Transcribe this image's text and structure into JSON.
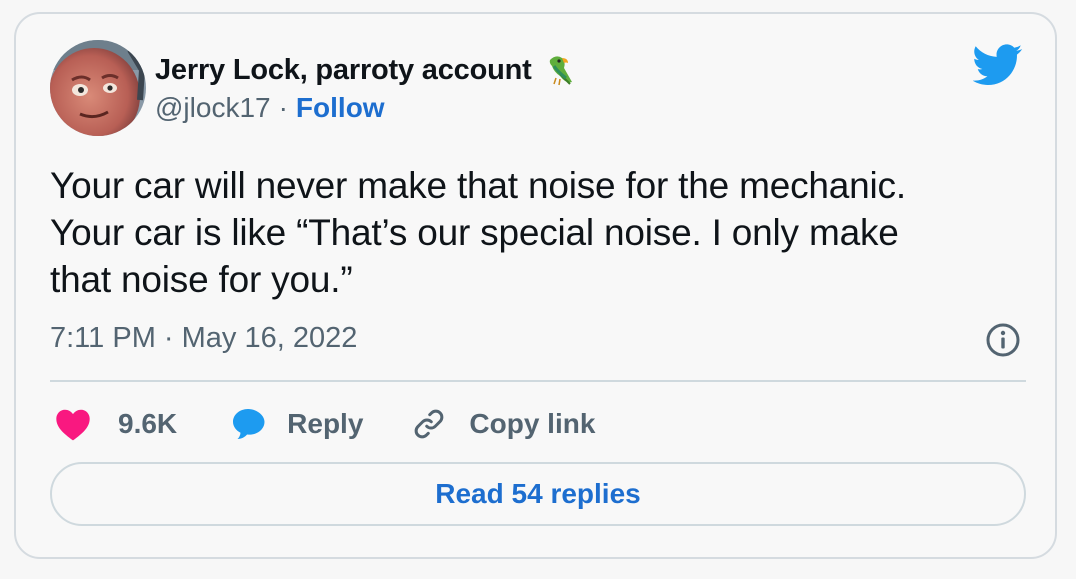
{
  "author": {
    "name": "Jerry Lock, parroty account",
    "handle": "@jlock17",
    "separator": "·",
    "follow_label": "Follow",
    "avatar_icon": "profile-photo",
    "badge_icon": "parrot-emoji"
  },
  "tweet": {
    "lines": [
      "Your car will never make that noise for the mechanic.",
      "Your car is like “That’s our special noise. I only make",
      "that noise for you.”"
    ],
    "timestamp": "7:11 PM · May 16, 2022"
  },
  "actions": {
    "like_count": "9.6K",
    "reply_label": "Reply",
    "copy_link_label": "Copy link"
  },
  "footer": {
    "read_replies_label": "Read 54 replies"
  },
  "colors": {
    "like": "#f91880",
    "reply": "#1d9bf0",
    "link": "#1d6ecf",
    "twitter_blue": "#1d9bf0"
  }
}
